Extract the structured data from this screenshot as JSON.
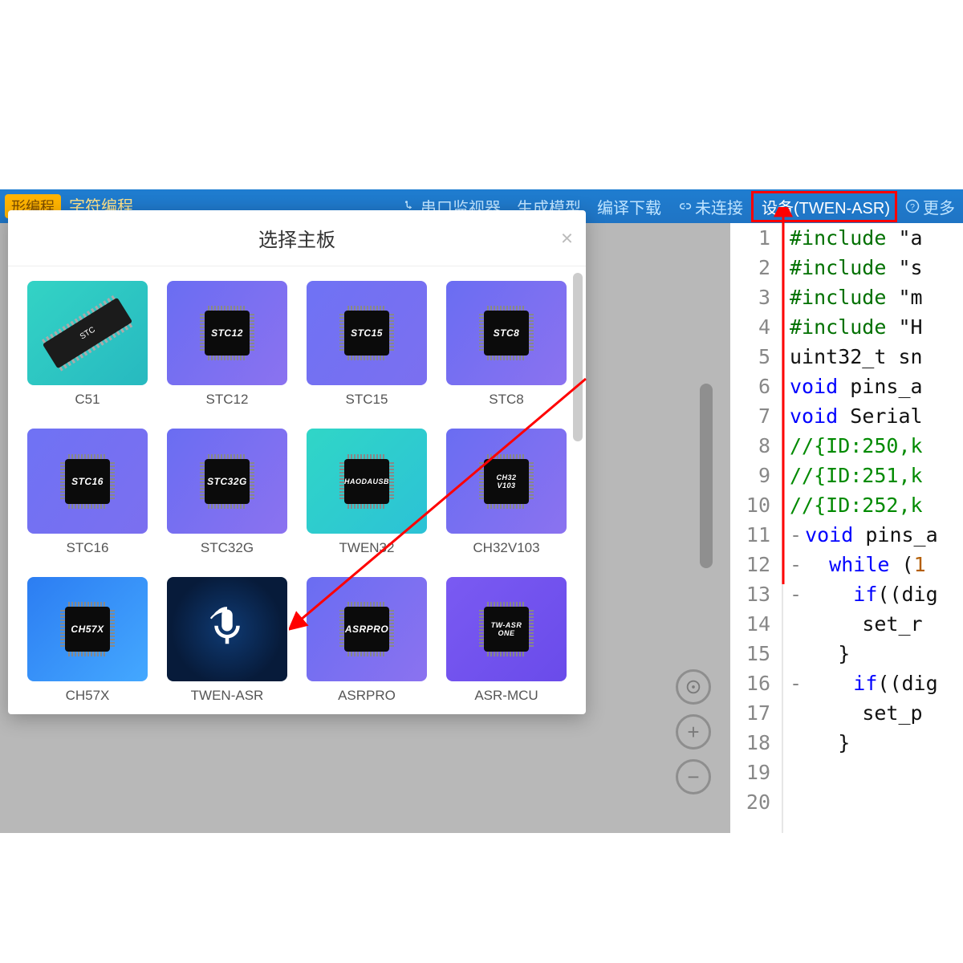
{
  "toolbar": {
    "left_pill_1": "形编程",
    "left_tab": "字符编程",
    "serial_monitor": "串口监视器",
    "generate_model": "生成模型",
    "compile_download": "编译下载",
    "not_connected": "未连接",
    "device_prefix": "设备",
    "device_name": "(TWEN-ASR)",
    "more": "更多"
  },
  "modal": {
    "title": "选择主板",
    "boards": [
      {
        "label": "C51",
        "chip": "STC",
        "style": "teal",
        "dip": true
      },
      {
        "label": "STC12",
        "chip": "STC12",
        "style": "violet"
      },
      {
        "label": "STC15",
        "chip": "STC15",
        "style": "violet2"
      },
      {
        "label": "STC8",
        "chip": "STC8",
        "style": "violet"
      },
      {
        "label": "STC16",
        "chip": "STC16",
        "style": "violet2"
      },
      {
        "label": "STC32G",
        "chip": "STC32G",
        "style": "violet"
      },
      {
        "label": "TWEN32",
        "chip": "HAODAUSB",
        "style": "cyan"
      },
      {
        "label": "CH32V103",
        "chip": "CH32\nV103",
        "style": "violet"
      },
      {
        "label": "CH57X",
        "chip": "CH57X",
        "style": "blue"
      },
      {
        "label": "TWEN-ASR",
        "chip": "",
        "style": "dark",
        "mic": true
      },
      {
        "label": "ASRPRO",
        "chip": "ASRPRO",
        "style": "violet"
      },
      {
        "label": "ASR-MCU",
        "chip": "TW-ASR\nONE",
        "style": "purple"
      }
    ]
  },
  "code": {
    "lines": [
      {
        "n": 1,
        "html": "<span class='tok-pp'>#include</span> <span class='tok-idt'>\"a</span>"
      },
      {
        "n": 2,
        "html": "<span class='tok-pp'>#include</span> <span class='tok-idt'>\"s</span>"
      },
      {
        "n": 3,
        "html": "<span class='tok-pp'>#include</span> <span class='tok-idt'>\"m</span>"
      },
      {
        "n": 4,
        "html": "<span class='tok-pp'>#include</span> <span class='tok-idt'>\"H</span>"
      },
      {
        "n": 5,
        "html": ""
      },
      {
        "n": 6,
        "html": "<span class='tok-idt'>uint32_t sn</span>"
      },
      {
        "n": 7,
        "html": "<span class='tok-kw'>void</span> <span class='tok-idt'>pins_a</span>"
      },
      {
        "n": 8,
        "html": "<span class='tok-kw'>void</span> <span class='tok-idt'>Serial</span>"
      },
      {
        "n": 9,
        "html": ""
      },
      {
        "n": 10,
        "html": "<span class='tok-cmt'>//{ID:250,k</span>"
      },
      {
        "n": 11,
        "html": "<span class='tok-cmt'>//{ID:251,k</span>"
      },
      {
        "n": 12,
        "html": "<span class='tok-cmt'>//{ID:252,k</span>"
      },
      {
        "n": 13,
        "fold": "-",
        "html": "<span class='tok-kw'>void</span> <span class='tok-idt'>pins_a</span>"
      },
      {
        "n": 14,
        "fold": "-",
        "html": "&nbsp;&nbsp;<span class='tok-kw'>while</span> <span class='tok-idt'>(</span><span class='tok-num'>1</span>"
      },
      {
        "n": 15,
        "fold": "-",
        "html": "&nbsp;&nbsp;&nbsp;&nbsp;<span class='tok-kw'>if</span><span class='tok-idt'>((dig</span>"
      },
      {
        "n": 16,
        "html": "&nbsp;&nbsp;&nbsp;&nbsp;&nbsp;&nbsp;<span class='tok-idt'>set_r</span>"
      },
      {
        "n": 17,
        "html": "&nbsp;&nbsp;&nbsp;&nbsp;<span class='tok-idt'>}</span>"
      },
      {
        "n": 18,
        "fold": "-",
        "html": "&nbsp;&nbsp;&nbsp;&nbsp;<span class='tok-kw'>if</span><span class='tok-idt'>((dig</span>"
      },
      {
        "n": 19,
        "html": "&nbsp;&nbsp;&nbsp;&nbsp;&nbsp;&nbsp;<span class='tok-idt'>set_p</span>"
      },
      {
        "n": 20,
        "html": "&nbsp;&nbsp;&nbsp;&nbsp;<span class='tok-idt'>}</span>"
      }
    ]
  }
}
